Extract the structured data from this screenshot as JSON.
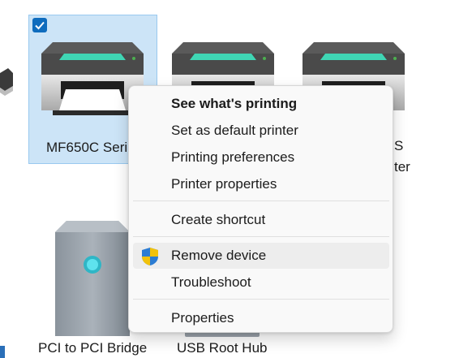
{
  "devices": [
    {
      "label": "MF650C Seri",
      "selected": true
    },
    {
      "label": "S"
    },
    {
      "label": "ter"
    },
    {
      "label": "PCI to PCI Bridge"
    },
    {
      "label": "USB Root Hub"
    }
  ],
  "context_menu": {
    "items": [
      {
        "label": "See what's printing",
        "bold": true
      },
      {
        "label": "Set as default printer"
      },
      {
        "label": "Printing preferences"
      },
      {
        "label": "Printer properties"
      },
      {
        "label": "Create shortcut"
      },
      {
        "label": "Remove device",
        "icon": "uac-shield-icon",
        "hovered": true
      },
      {
        "label": "Troubleshoot"
      },
      {
        "label": "Properties"
      }
    ]
  },
  "colors": {
    "selection": "#cce4f7",
    "selection_border": "#99c9ef",
    "checkbox": "#0f6cbd",
    "printer_accent": "#3fd6b4",
    "menu_bg": "#f9f9f9",
    "menu_hover": "#ededed"
  }
}
